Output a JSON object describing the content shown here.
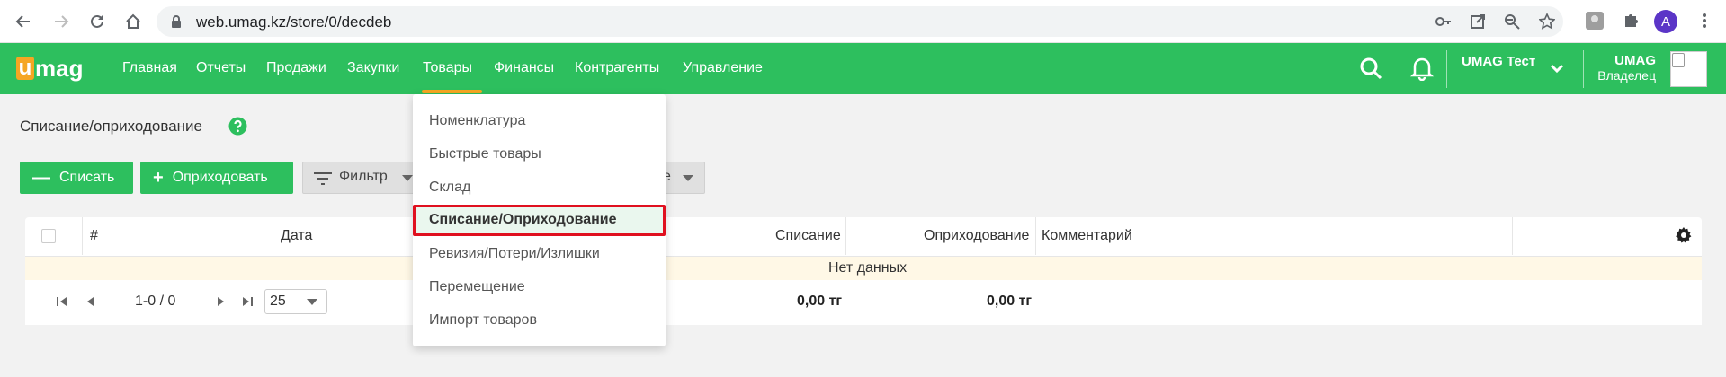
{
  "browser": {
    "url": "web.umag.kz/store/0/decdeb",
    "profile_initial": "A",
    "accent": "#5b35c7"
  },
  "app": {
    "logo_first": "u",
    "logo_rest": "mag",
    "brand_color": "#2dbf5e",
    "highlight_color": "#f5a623",
    "menu": [
      {
        "label": "Главная"
      },
      {
        "label": "Отчеты"
      },
      {
        "label": "Продажи"
      },
      {
        "label": "Закупки"
      },
      {
        "label": "Товары"
      },
      {
        "label": "Финансы"
      },
      {
        "label": "Контрагенты"
      },
      {
        "label": "Управление"
      }
    ],
    "active_menu": "Товары",
    "org_name": "UMAG Тест",
    "user_name": "UMAG",
    "user_role": "Владелец"
  },
  "page": {
    "title": "Списание/оприходование",
    "buttons": {
      "writeoff": "Списать",
      "receive": "Оприходовать",
      "filter": "Фильтр",
      "partial_hidden": "е"
    },
    "table": {
      "columns": [
        "#",
        "Дата",
        "Списание",
        "Оприходование",
        "Комментарий"
      ],
      "empty_text": "Нет данных",
      "range": "1-0 / 0",
      "page_size": "25",
      "total_writeoff": "0,00 тг",
      "total_receive": "0,00 тг"
    }
  },
  "dropdown": {
    "items": [
      {
        "label": "Номенклатура"
      },
      {
        "label": "Быстрые товары"
      },
      {
        "label": "Склад"
      },
      {
        "label": "Списание/Оприходование"
      },
      {
        "label": "Ревизия/Потери/Излишки"
      },
      {
        "label": "Перемещение"
      },
      {
        "label": "Импорт товаров"
      }
    ],
    "active_index": 3,
    "active_border_color": "#e0101f"
  }
}
